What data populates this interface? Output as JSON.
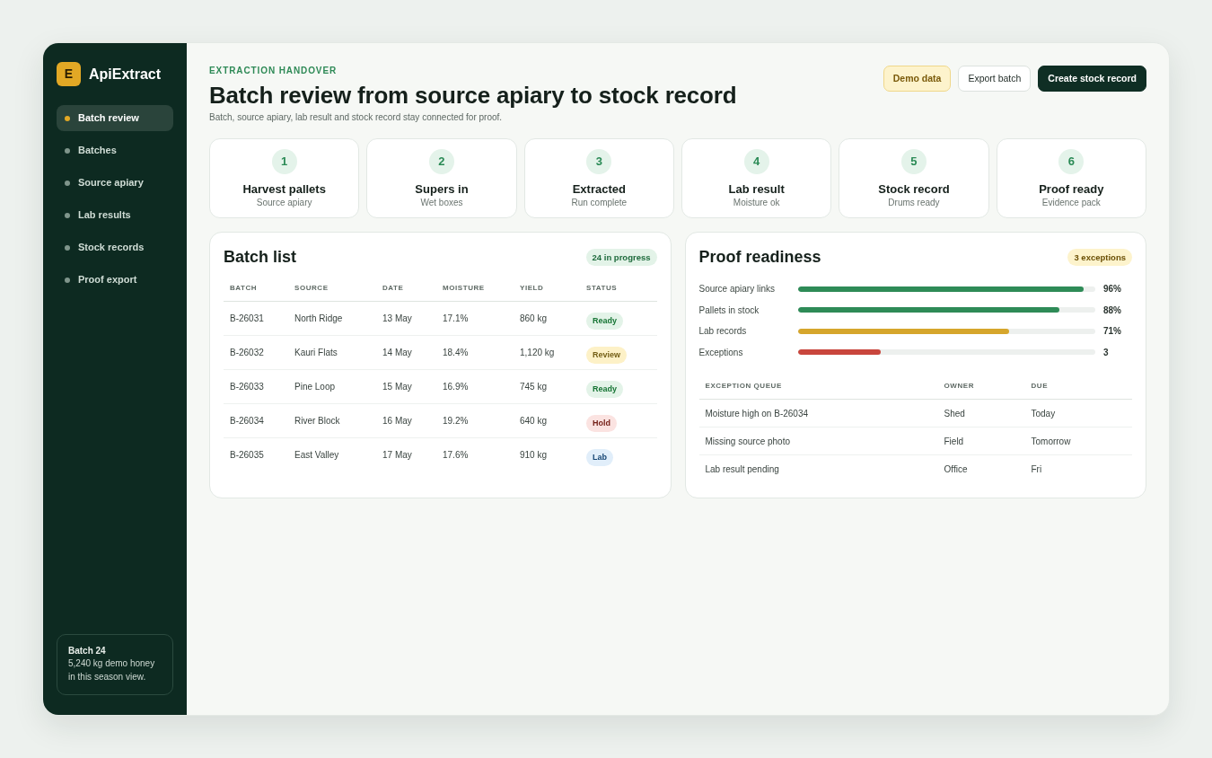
{
  "sidebar": {
    "logo_letter": "E",
    "app_name": "ApiExtract",
    "items": [
      {
        "label": "Batch review",
        "selected": true
      },
      {
        "label": "Batches",
        "selected": false
      },
      {
        "label": "Source apiary",
        "selected": false
      },
      {
        "label": "Lab results",
        "selected": false
      },
      {
        "label": "Stock records",
        "selected": false
      },
      {
        "label": "Proof export",
        "selected": false
      }
    ],
    "summary": {
      "title": "Batch 24",
      "text": "5,240 kg demo honey in this season view."
    }
  },
  "header": {
    "eyebrow": "EXTRACTION HANDOVER",
    "title": "Batch review from source apiary to stock record",
    "subtitle": "Batch, source apiary, lab result and stock record stay connected for proof.",
    "badge": "Demo data",
    "buttons": [
      {
        "label": "Export batch",
        "kind": "secondary"
      },
      {
        "label": "Create stock record",
        "kind": "primary"
      }
    ]
  },
  "steps": [
    {
      "number": "1",
      "title": "Harvest pallets",
      "subtitle": "Source apiary"
    },
    {
      "number": "2",
      "title": "Supers in",
      "subtitle": "Wet boxes"
    },
    {
      "number": "3",
      "title": "Extracted",
      "subtitle": "Run complete"
    },
    {
      "number": "4",
      "title": "Lab result",
      "subtitle": "Moisture ok"
    },
    {
      "number": "5",
      "title": "Stock record",
      "subtitle": "Drums ready"
    },
    {
      "number": "6",
      "title": "Proof ready",
      "subtitle": "Evidence pack"
    }
  ],
  "batch_list": {
    "title": "Batch list",
    "badge": "24 in progress",
    "columns": [
      "BATCH",
      "SOURCE",
      "DATE",
      "MOISTURE",
      "YIELD",
      "STATUS"
    ],
    "rows": [
      {
        "cells": [
          "B-26031",
          "North Ridge",
          "13 May",
          "17.1%",
          "860 kg"
        ],
        "status": {
          "label": "Ready",
          "color": "#e3f3e8"
        }
      },
      {
        "cells": [
          "B-26032",
          "Kauri Flats",
          "14 May",
          "18.4%",
          "1,120 kg"
        ],
        "status": {
          "label": "Review",
          "color": "#fdf1c7"
        }
      },
      {
        "cells": [
          "B-26033",
          "Pine Loop",
          "15 May",
          "16.9%",
          "745 kg"
        ],
        "status": {
          "label": "Ready",
          "color": "#e3f3e8"
        }
      },
      {
        "cells": [
          "B-26034",
          "River Block",
          "16 May",
          "19.2%",
          "640 kg"
        ],
        "status": {
          "label": "Hold",
          "color": "#fbe3e1"
        }
      },
      {
        "cells": [
          "B-26035",
          "East Valley",
          "17 May",
          "17.6%",
          "910 kg"
        ],
        "status": {
          "label": "Lab",
          "color": "#e1eefa"
        }
      }
    ]
  },
  "proof_readiness": {
    "title": "Proof readiness",
    "badge": "3 exceptions",
    "metrics": [
      {
        "label": "Source apiary links",
        "level": 0.96,
        "value": "96%",
        "color": "#2e8b57"
      },
      {
        "label": "Pallets in stock",
        "level": 0.88,
        "value": "88%",
        "color": "#2e8b57"
      },
      {
        "label": "Lab records",
        "level": 0.71,
        "value": "71%",
        "color": "#d6a62c"
      },
      {
        "label": "Exceptions",
        "level": 0.28,
        "value": "3",
        "color": "#c9463d"
      }
    ],
    "queue": {
      "columns": [
        "EXCEPTION QUEUE",
        "OWNER",
        "DUE"
      ],
      "rows": [
        [
          "Moisture high on B-26034",
          "Shed",
          "Today"
        ],
        [
          "Missing source photo",
          "Field",
          "Tomorrow"
        ],
        [
          "Lab result pending",
          "Office",
          "Fri"
        ]
      ]
    }
  }
}
